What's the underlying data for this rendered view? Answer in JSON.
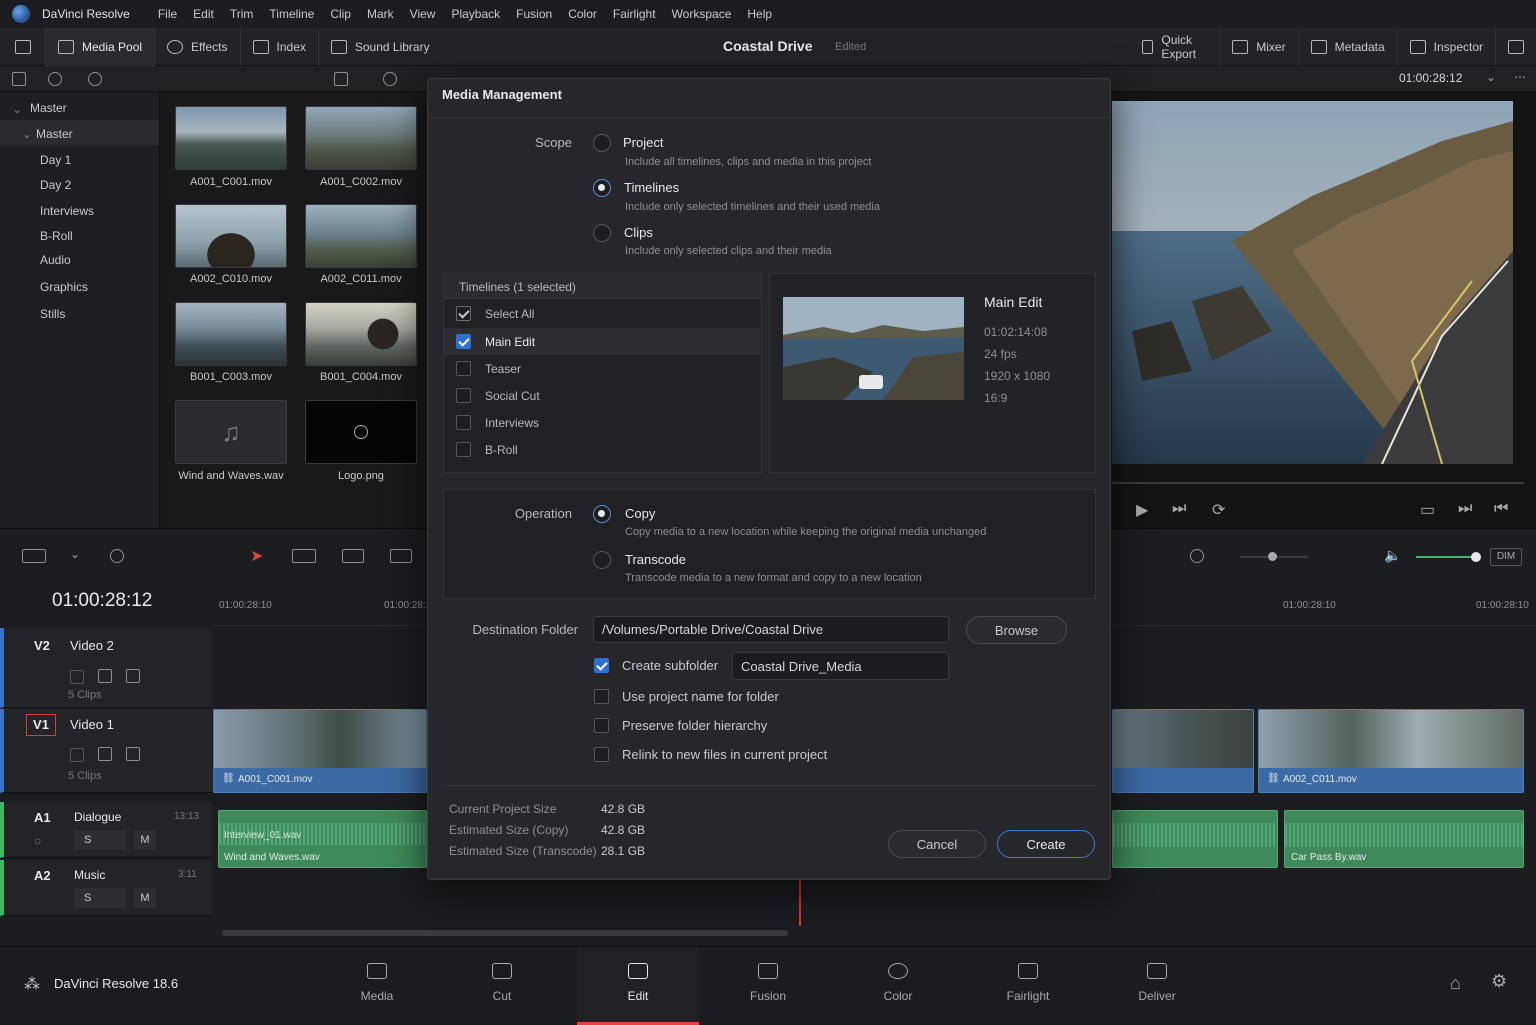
{
  "app": {
    "name": "DaVinci Resolve",
    "menu": [
      "File",
      "Edit",
      "Trim",
      "Timeline",
      "Clip",
      "Mark",
      "View",
      "Playback",
      "Fusion",
      "Color",
      "Fairlight",
      "Workspace",
      "Help"
    ]
  },
  "toolbar": {
    "media_pool": "Media Pool",
    "effects": "Effects",
    "index": "Index",
    "sound_library": "Sound Library",
    "project_title": "Coastal Drive",
    "project_status": "Edited",
    "quick_export": "Quick Export",
    "mixer": "Mixer",
    "metadata": "Metadata",
    "inspector": "Inspector"
  },
  "viewer": {
    "timecode": "01:00:28:12"
  },
  "sidebar": {
    "items": [
      {
        "label": "Master"
      },
      {
        "label": "Master"
      },
      {
        "label": "Day 1"
      },
      {
        "label": "Day 2"
      },
      {
        "label": "Interviews"
      },
      {
        "label": "B-Roll"
      },
      {
        "label": "Audio"
      },
      {
        "label": "Graphics"
      },
      {
        "label": "Stills"
      }
    ]
  },
  "media_pool": {
    "clips": [
      {
        "name": "A001_C001.mov"
      },
      {
        "name": "A001_C002.mov"
      },
      {
        "name": "A002_C010.mov"
      },
      {
        "name": "A002_C011.mov"
      },
      {
        "name": "B001_C003.mov"
      },
      {
        "name": "B001_C004.mov"
      },
      {
        "name": "Wind and Waves.wav"
      },
      {
        "name": "Logo.png"
      }
    ]
  },
  "timeline": {
    "timecode": "01:00:28:12",
    "ruler": [
      "01:00:28:10",
      "01:00:28:10",
      "01:00:28:10",
      "01:00:28:10"
    ],
    "tracks": [
      {
        "id": "V2",
        "name": "Video 2",
        "clips_count": "5 Clips"
      },
      {
        "id": "V1",
        "name": "Video 1",
        "clips_count": "5 Clips"
      },
      {
        "id": "A1",
        "name": "Dialogue",
        "duration": "13:13",
        "solo": "S",
        "mute": "M"
      },
      {
        "id": "A2",
        "name": "Music",
        "duration": "3:11",
        "solo": "S",
        "mute": "M"
      }
    ],
    "clips": {
      "v1_left": "A001_C001.mov",
      "v1_right": "A002_C011.mov",
      "a1_top": "Interview_01.wav",
      "a1_left": "Wind and Waves.wav",
      "a2_right": "Car Pass By.wav",
      "dim": "DIM"
    }
  },
  "pages": {
    "version": "DaVinci Resolve 18.6",
    "tabs": [
      {
        "label": "Media"
      },
      {
        "label": "Cut"
      },
      {
        "label": "Edit"
      },
      {
        "label": "Fusion"
      },
      {
        "label": "Color"
      },
      {
        "label": "Fairlight"
      },
      {
        "label": "Deliver"
      }
    ],
    "active": "Edit"
  },
  "dialog": {
    "title": "Media Management",
    "scope_label": "Scope",
    "scope_options": [
      {
        "title": "Project",
        "desc": "Include all timelines, clips and media in this project",
        "selected": false
      },
      {
        "title": "Timelines",
        "desc": "Include only selected timelines and their used media",
        "selected": true
      },
      {
        "title": "Clips",
        "desc": "Include only selected clips and their media",
        "selected": false
      }
    ],
    "timelines_header": "Timelines (1 selected)",
    "timelines": [
      {
        "label": "Select All",
        "checked": true
      },
      {
        "label": "Main Edit",
        "checked": true
      },
      {
        "label": "Teaser",
        "checked": false
      },
      {
        "label": "Social Cut",
        "checked": false
      },
      {
        "label": "Interviews",
        "checked": false
      },
      {
        "label": "B-Roll",
        "checked": false
      }
    ],
    "preview": {
      "name": "Main Edit",
      "duration": "01:02:14:08",
      "fps": "24 fps",
      "resolution": "1920 x 1080",
      "aspect": "16:9"
    },
    "operation_label": "Operation",
    "operation_options": [
      {
        "title": "Copy",
        "desc": "Copy media to a new location while keeping the original media unchanged",
        "selected": true
      },
      {
        "title": "Transcode",
        "desc": "Transcode media to a new format and copy to a new location",
        "selected": false
      }
    ],
    "destination_label": "Destination Folder",
    "destination_path": "/Volumes/Portable Drive/Coastal Drive",
    "browse": "Browse",
    "subfolder_checkbox": "Create subfolder",
    "subfolder_name": "Coastal Drive_Media",
    "options": [
      {
        "label": "Use project name for folder",
        "checked": false
      },
      {
        "label": "Preserve folder hierarchy",
        "checked": false
      },
      {
        "label": "Relink to new files in current project",
        "checked": false
      }
    ],
    "sizes": [
      {
        "label": "Current Project Size",
        "value": "42.8 GB"
      },
      {
        "label": "Estimated Size (Copy)",
        "value": "42.8 GB"
      },
      {
        "label": "Estimated Size (Transcode)",
        "value": "28.1 GB"
      }
    ],
    "cancel": "Cancel",
    "create": "Create"
  }
}
